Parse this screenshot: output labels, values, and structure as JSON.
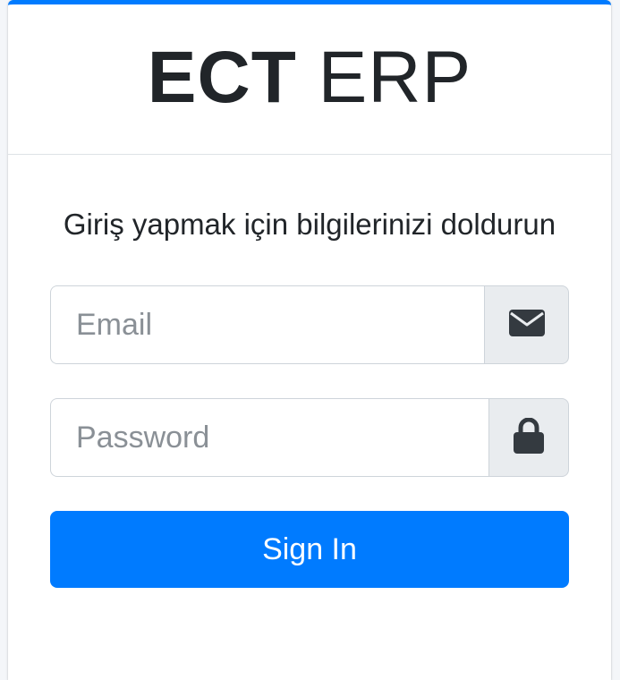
{
  "brand": {
    "bold": "ECT",
    "light": "ERP"
  },
  "login": {
    "message": "Giriş yapmak için bilgilerinizi doldurun",
    "email_placeholder": "Email",
    "password_placeholder": "Password",
    "signin_label": "Sign In"
  },
  "icons": {
    "email": "envelope-icon",
    "password": "lock-icon"
  },
  "colors": {
    "accent": "#007bff",
    "addon_bg": "#e9ecef",
    "icon": "#343a40"
  }
}
